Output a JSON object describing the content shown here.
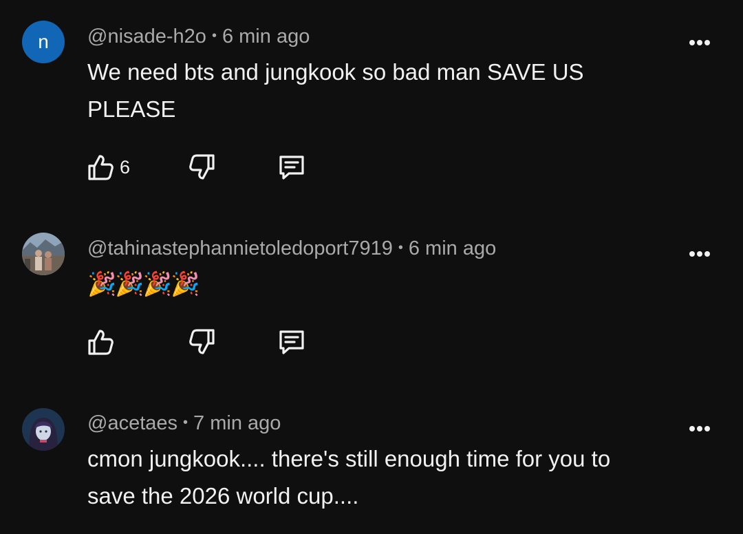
{
  "comments": [
    {
      "avatar_letter": "n",
      "handle": "@nisade-h2o",
      "time": "6 min ago",
      "text_line1": "We need bts and jungkook so bad man SAVE US",
      "text_line2": "PLEASE",
      "like_count": "6"
    },
    {
      "handle": "@tahinastephannietoledoport7919",
      "time": "6 min ago",
      "text": "🎉🎉🎉🎉",
      "like_count": ""
    },
    {
      "handle": "@acetaes",
      "time": "7 min ago",
      "text_line1": "cmon jungkook.... there's still enough time for you to",
      "text_line2": "save the 2026 world cup...."
    }
  ],
  "separator": "•",
  "icons": {
    "like": "thumbs-up-icon",
    "dislike": "thumbs-down-icon",
    "reply": "reply-icon",
    "menu": "more-options-icon"
  },
  "colors": {
    "background": "#0f0f0f",
    "text": "#f1f1f1",
    "meta": "#aaaaaa",
    "avatar_n": "#1166b5"
  }
}
